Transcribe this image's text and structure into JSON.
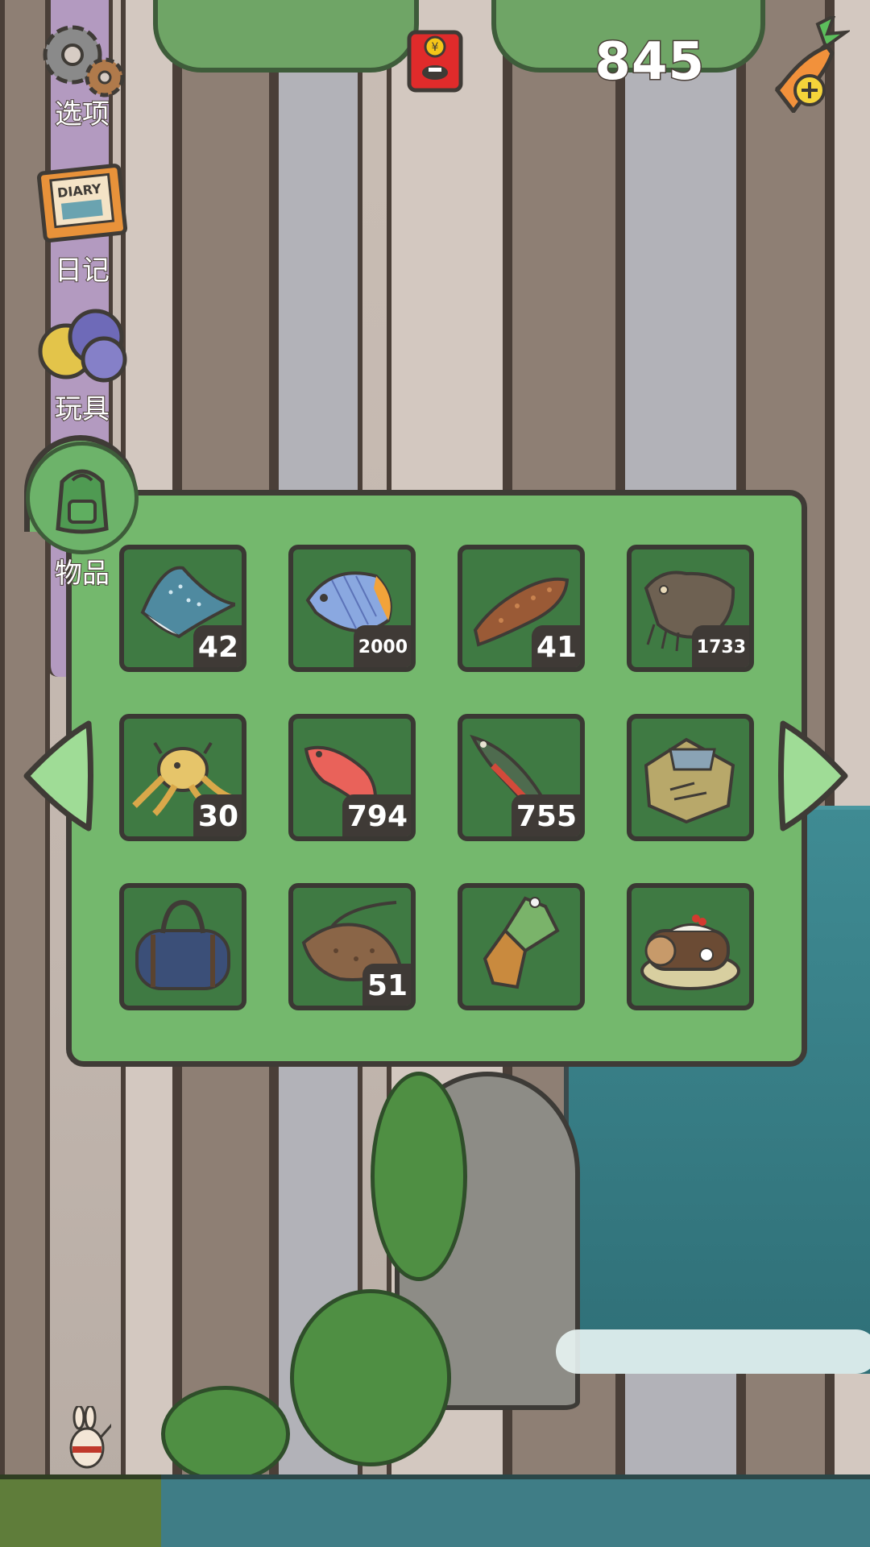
{
  "hud": {
    "currency_amount": "845",
    "currency_icon": "carrot-add-icon",
    "gift_icon": "red-envelope-icon"
  },
  "menu": {
    "items": [
      {
        "label": "选项",
        "icon": "gear-icon"
      },
      {
        "label": "日记",
        "icon": "diary-icon"
      },
      {
        "label": "玩具",
        "icon": "toy-balls-icon"
      },
      {
        "label": "物品",
        "icon": "backpack-icon",
        "active": true
      }
    ]
  },
  "inventory": {
    "items": [
      {
        "icon": "eagle-ray-icon",
        "count": "42"
      },
      {
        "icon": "butterflyfish-icon",
        "count": "2000"
      },
      {
        "icon": "sea-cucumber-icon",
        "count": "41"
      },
      {
        "icon": "scorpionfish-icon",
        "count": "1733"
      },
      {
        "icon": "octopus-icon",
        "count": "30"
      },
      {
        "icon": "red-snapper-icon",
        "count": "794"
      },
      {
        "icon": "trout-icon",
        "count": "755"
      },
      {
        "icon": "map-scroll-icon",
        "count": ""
      },
      {
        "icon": "duffel-bag-icon",
        "count": ""
      },
      {
        "icon": "stingray-icon",
        "count": "51"
      },
      {
        "icon": "taiyaki-ice-cream-icon",
        "count": ""
      },
      {
        "icon": "yule-log-cake-icon",
        "count": ""
      }
    ]
  },
  "colors": {
    "panel_green": "#74b86d",
    "slot_green": "#3f7a43",
    "outline": "#3f3b36",
    "menu_rail": "#b39ac0"
  }
}
